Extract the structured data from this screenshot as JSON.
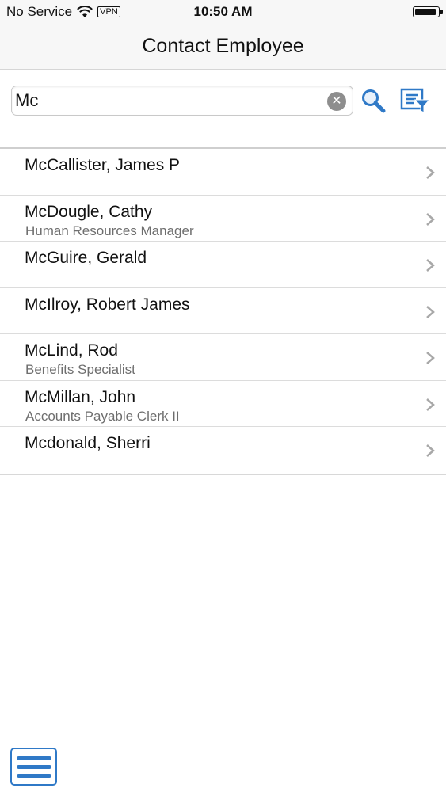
{
  "status_bar": {
    "carrier": "No Service",
    "vpn": "VPN",
    "time": "10:50 AM"
  },
  "header": {
    "title": "Contact Employee"
  },
  "search": {
    "value": "Mc",
    "placeholder": ""
  },
  "icons": {
    "wifi": "wifi-icon",
    "battery": "battery-icon",
    "clear": "clear-icon",
    "search": "search-icon",
    "filter": "filter-icon",
    "chevron": "chevron-right-icon",
    "menu": "hamburger-menu-icon"
  },
  "colors": {
    "accent": "#2f79c7",
    "secondary_text": "#6e6e6e",
    "header_bg": "#f7f7f7"
  },
  "employees": [
    {
      "name": "McCallister, James P",
      "title": ""
    },
    {
      "name": "McDougle, Cathy",
      "title": "Human Resources Manager"
    },
    {
      "name": "McGuire, Gerald",
      "title": ""
    },
    {
      "name": "McIlroy, Robert James",
      "title": ""
    },
    {
      "name": "McLind, Rod",
      "title": "Benefits Specialist"
    },
    {
      "name": "McMillan, John",
      "title": "Accounts Payable Clerk II"
    },
    {
      "name": "Mcdonald, Sherri",
      "title": ""
    }
  ]
}
